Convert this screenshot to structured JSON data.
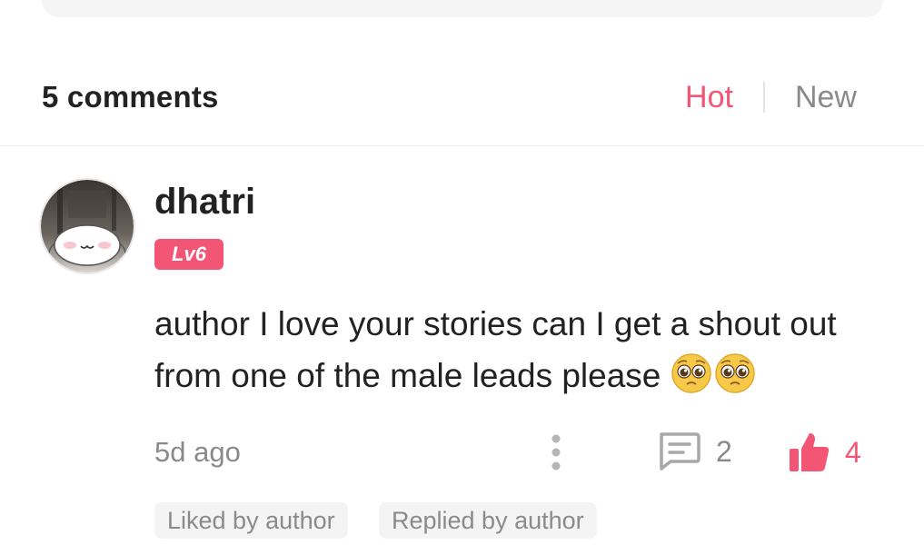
{
  "comments_header": {
    "count_label": "5 comments",
    "sort_tabs": [
      {
        "label": "Hot",
        "active": true
      },
      {
        "label": "New",
        "active": false
      }
    ]
  },
  "comment": {
    "username": "dhatri",
    "level": "Lv6",
    "text": "author I love your stories can I get a shout out from one of the male leads please",
    "emojis": [
      "pleading-face-emoji",
      "pleading-face-emoji"
    ],
    "time": "5d ago",
    "reply_count": "2",
    "like_count": "4",
    "tags": [
      "Liked by author",
      "Replied by author"
    ]
  },
  "icons": {
    "more": "vertical-dots-icon",
    "reply": "comment-bubble-icon",
    "like": "thumbs-up-icon"
  },
  "colors": {
    "accent": "#f25674",
    "muted_text": "#8a8a8a",
    "primary_text": "#222222",
    "tag_background": "#f4f4f4"
  }
}
